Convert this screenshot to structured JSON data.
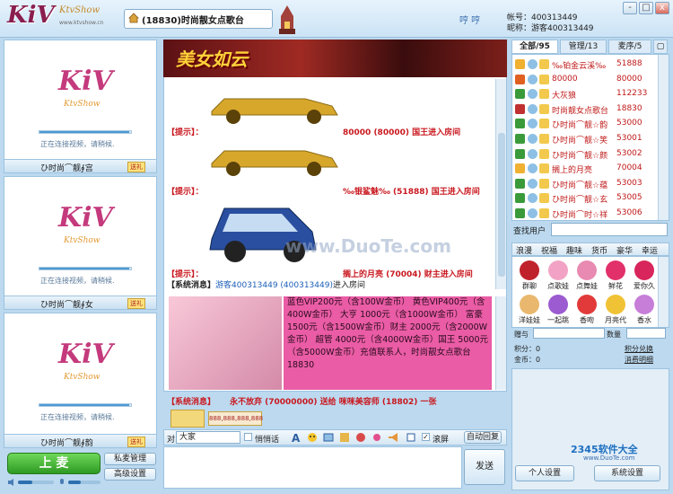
{
  "header": {
    "logo": "KiV",
    "logo_sub": "KtvShow",
    "logo_url": "www.ktvshow.cn",
    "room_title": "(18830)时尚靓女点歌台",
    "mini_label": "哼 哼",
    "account_label": "帐号：400313449",
    "nickname_label": "昵称：游客400313449",
    "win_controls": [
      "-",
      "□",
      "x"
    ]
  },
  "left": {
    "video_logo": "KiV",
    "video_sub": "KtvShow",
    "connecting": "正在连接视频，请稍候.",
    "users": [
      {
        "name": "ひ时尚⌒靓∮宫",
        "gift": "送礼"
      },
      {
        "name": "ひ时尚⌒靓∮女",
        "gift": "送礼"
      },
      {
        "name": "ひ时尚⌒靓∮韵",
        "gift": "送礼"
      }
    ],
    "connect_progress": 0.98
  },
  "controls": {
    "mic_button": "上 麦",
    "private_manage": "私麦管理",
    "advanced": "高级设置"
  },
  "banner": {
    "text": "美女如云"
  },
  "chat": {
    "messages": [
      {
        "tag": "【提示】：",
        "text": "80000 (80000)  国王进入房间"
      },
      {
        "tag": "【提示】：",
        "text": "‰银鲨魅‰ (51888)  国王进入房间"
      },
      {
        "tag": "【提示】：",
        "text": "搁上的月亮 (70004)  财主进入房间"
      }
    ],
    "system_label": "【系统消息】",
    "system_text": "游客400313449 (400313449)",
    "system_suffix": "进入房间",
    "watermark": "www.DuoTe.com"
  },
  "notice": {
    "text": "蓝色VIP200元（含100W金币） 黄色VIP400元（含400W金币） 大亨 1000元（含1000W金币） 富豪 1500元（含1500W金币）财主 2000元（含2000W金币） 超管 4000元（含4000W金币）国王 5000元（含5000W金币）充值联系人，时尚靓女点歌台18830",
    "system_label": "【系统消息】",
    "system_text": "永不放弃 (70000000)  送给  咪咪美容师 (18802)  一张",
    "card_text": "888,888,888,888"
  },
  "toolbar": {
    "to_label": "对",
    "to_value": "大家",
    "whisper": "悄悄话",
    "scroll": "滚屏",
    "auto_reply": "自动回复",
    "send": "发送"
  },
  "right": {
    "tabs": [
      {
        "label": "全部/95"
      },
      {
        "label": "管理/13"
      },
      {
        "label": "麦序/5"
      }
    ],
    "users": [
      {
        "name": "‰铂金云溪‰",
        "id": "51888"
      },
      {
        "name": "80000",
        "id": "80000"
      },
      {
        "name": "大灰狼",
        "id": "112233"
      },
      {
        "name": "时尚靓女点歌台",
        "id": "18830"
      },
      {
        "name": "ひ时尚⌒靓☆韵",
        "id": "53000"
      },
      {
        "name": "ひ时尚⌒靓☆笑",
        "id": "53001"
      },
      {
        "name": "ひ时尚⌒靓☆颜",
        "id": "53002"
      },
      {
        "name": "搁上的月亮",
        "id": "70004"
      },
      {
        "name": "ひ时尚⌒靓☆蕴",
        "id": "53003"
      },
      {
        "name": "ひ时尚⌒靓☆玄",
        "id": "53005"
      },
      {
        "name": "ひ时尚⌒时☆祥",
        "id": "53006"
      }
    ],
    "search_label": "查找用户",
    "gift_tabs": [
      "浪漫",
      "祝福",
      "趣味",
      "货币",
      "豪华",
      "幸运"
    ],
    "gifts": [
      {
        "name": "群聊",
        "color": "#c0222b"
      },
      {
        "name": "点歌娃",
        "color": "#f2a3c5"
      },
      {
        "name": "点舞娃",
        "color": "#e88ab1"
      },
      {
        "name": "鲜花",
        "color": "#e2306a"
      },
      {
        "name": "爱你久",
        "color": "#d8255b"
      },
      {
        "name": "洋娃娃",
        "color": "#e9b86e"
      },
      {
        "name": "一起跳",
        "color": "#9c5bd0"
      },
      {
        "name": "香吻",
        "color": "#e23a3a"
      },
      {
        "name": "月亮代",
        "color": "#f0c235"
      },
      {
        "name": "香水",
        "color": "#c77ed9"
      }
    ],
    "gift_to": "赠与",
    "qty": "数量",
    "points": "积分：0",
    "gold": "金币：0",
    "points_exchange": "积分兑换",
    "consume": "消费明细",
    "personal_settings": "个人设置",
    "system_settings": "系统设置"
  },
  "watermarks": {
    "site": "2345软件大全",
    "url": "www.DuoTe.com"
  },
  "colors": {
    "accent": "#c9181f",
    "brand_pink": "#ea5ca5",
    "frame": "#9dc3e0"
  }
}
